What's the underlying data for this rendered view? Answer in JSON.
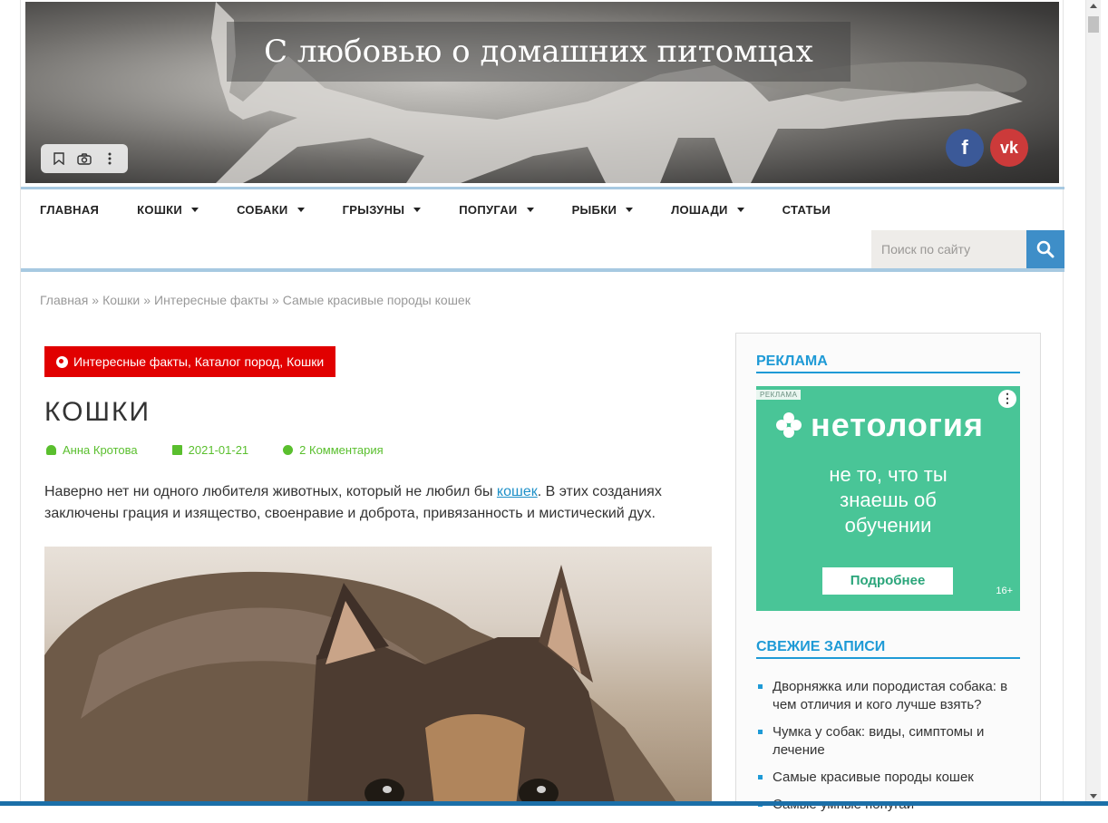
{
  "header": {
    "site_title": "С любовью о домашних питомцах",
    "social": [
      {
        "label": "f",
        "icon": "facebook-icon",
        "color": "#3b5998"
      },
      {
        "label": "vk",
        "icon": "vk-icon",
        "color": "#cc3a3a"
      }
    ]
  },
  "nav": {
    "items": [
      {
        "label": "ГЛАВНАЯ",
        "dropdown": false
      },
      {
        "label": "КОШКИ",
        "dropdown": true
      },
      {
        "label": "СОБАКИ",
        "dropdown": true
      },
      {
        "label": "ГРЫЗУНЫ",
        "dropdown": true
      },
      {
        "label": "ПОПУГАИ",
        "dropdown": true
      },
      {
        "label": "РЫБКИ",
        "dropdown": true
      },
      {
        "label": "ЛОШАДИ",
        "dropdown": true
      },
      {
        "label": "СТАТЬИ",
        "dropdown": false
      }
    ],
    "search_placeholder": "Поиск по сайту"
  },
  "breadcrumb": {
    "items": [
      "Главная",
      "Кошки",
      "Интересные факты",
      "Самые красивые породы кошек"
    ],
    "separator": "»"
  },
  "post": {
    "categories": "Интересные факты, Каталог пород, Кошки",
    "title": "КОШКИ",
    "author": "Анна Кротова",
    "date": "2021-01-21",
    "comments": "2 Комментария",
    "lead_before": "Наверно нет ни одного любителя животных, который не любил бы ",
    "lead_link": "кошек",
    "lead_after": ". В этих созданиях заключены грация и изящество, своенравие и доброта, привязанность и мистический дух."
  },
  "sidebar": {
    "ad_title": "РЕКЛАМА",
    "ad": {
      "tag": "РЕКЛАМА",
      "brand": "нетология",
      "text": "не то, что ты знаешь об обучении",
      "button": "Подробнее",
      "age": "16+"
    },
    "recent_title": "СВЕЖИЕ ЗАПИСИ",
    "recent": [
      "Дворняжка или породистая собака: в чем отличия и кого лучше взять?",
      "Чумка у собак: виды, симптомы и лечение",
      "Самые красивые породы кошек",
      "Самые умные попугаи"
    ]
  },
  "colors": {
    "accent_blue": "#1e9ad6",
    "category_red": "#e10000",
    "meta_green": "#5abf2e",
    "ad_green": "#49c597"
  }
}
